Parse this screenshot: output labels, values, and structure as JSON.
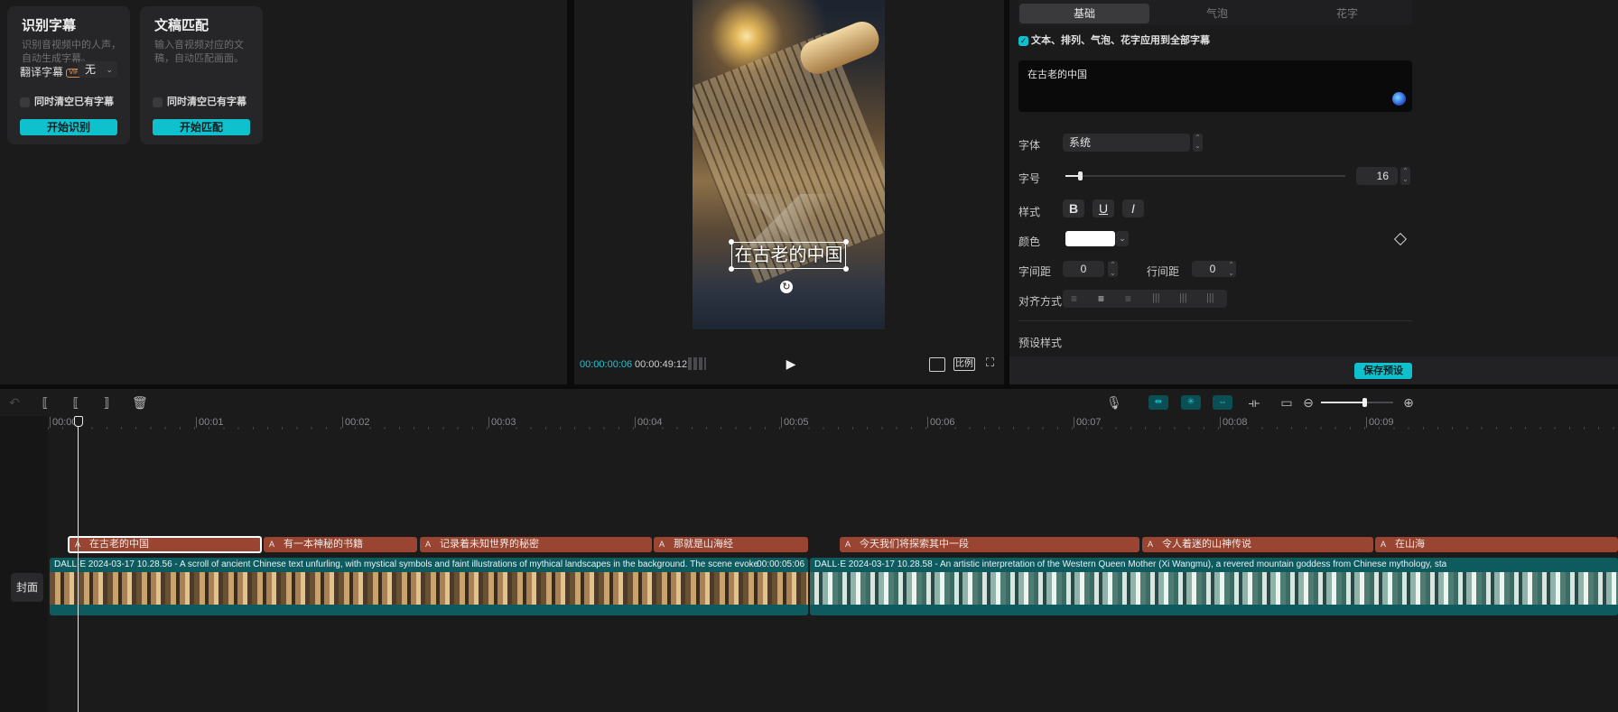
{
  "left_panel": {
    "recognize": {
      "title": "识别字幕",
      "desc": "识别音视频中的人声，自动生成字幕。",
      "translate_label": "翻译字幕",
      "vip_badge": "VIP",
      "translate_value": "无",
      "clear_label": "同时清空已有字幕",
      "button": "开始识别"
    },
    "match": {
      "title": "文稿匹配",
      "desc": "输入音视频对应的文稿，自动匹配画面。",
      "clear_label": "同时清空已有字幕",
      "button": "开始匹配"
    }
  },
  "preview": {
    "overlay_text": "在古老的中国",
    "current_time": "00:00:00:06",
    "total_time": "00:00:49:12",
    "ratio_label": "比例"
  },
  "right_panel": {
    "tabs": [
      "基础",
      "气泡",
      "花字"
    ],
    "apply_all_label": "文本、排列、气泡、花字应用到全部字幕",
    "text_value": "在古老的中国",
    "font_label": "字体",
    "font_value": "系统",
    "size_label": "字号",
    "size_value": "16",
    "size_fraction": 0.05,
    "style_label": "样式",
    "style_buttons": [
      "B",
      "U",
      "I"
    ],
    "color_label": "颜色",
    "color_value": "#ffffff",
    "letter_spacing_label": "字间距",
    "letter_spacing_value": "0",
    "line_spacing_label": "行间距",
    "line_spacing_value": "0",
    "align_label": "对齐方式",
    "preset_label": "预设样式",
    "save_preset_button": "保存预设"
  },
  "timeline": {
    "ruler": [
      "00:00",
      "00:01",
      "00:02",
      "00:03",
      "00:04",
      "00:05",
      "00:06",
      "00:07",
      "00:08",
      "00:09"
    ],
    "text_clips": [
      "在古老的中国",
      "有一本神秘的书籍",
      "记录着未知世界的秘密",
      "那就是山海经",
      "今天我们将探索其中一段",
      "令人着迷的山神传说",
      "在山海"
    ],
    "cover_label": "封面",
    "video_clips": [
      {
        "title": "DALL·E 2024-03-17 10.28.56 - A scroll of ancient Chinese text unfurling, with mystical symbols and faint illustrations of mythical landscapes in the background. The scene evokes a.webp",
        "duration": "00:00:05:06"
      },
      {
        "title": "DALL·E 2024-03-17 10.28.58 - An artistic interpretation of the Western Queen Mother (Xi Wangmu), a revered mountain goddess from Chinese mythology, sta",
        "duration": ""
      }
    ],
    "zoom_fraction": 0.6
  },
  "colors": {
    "accent": "#0fc1cc",
    "text_clip": "#9a4532",
    "video_track": "#0d5a5f"
  }
}
